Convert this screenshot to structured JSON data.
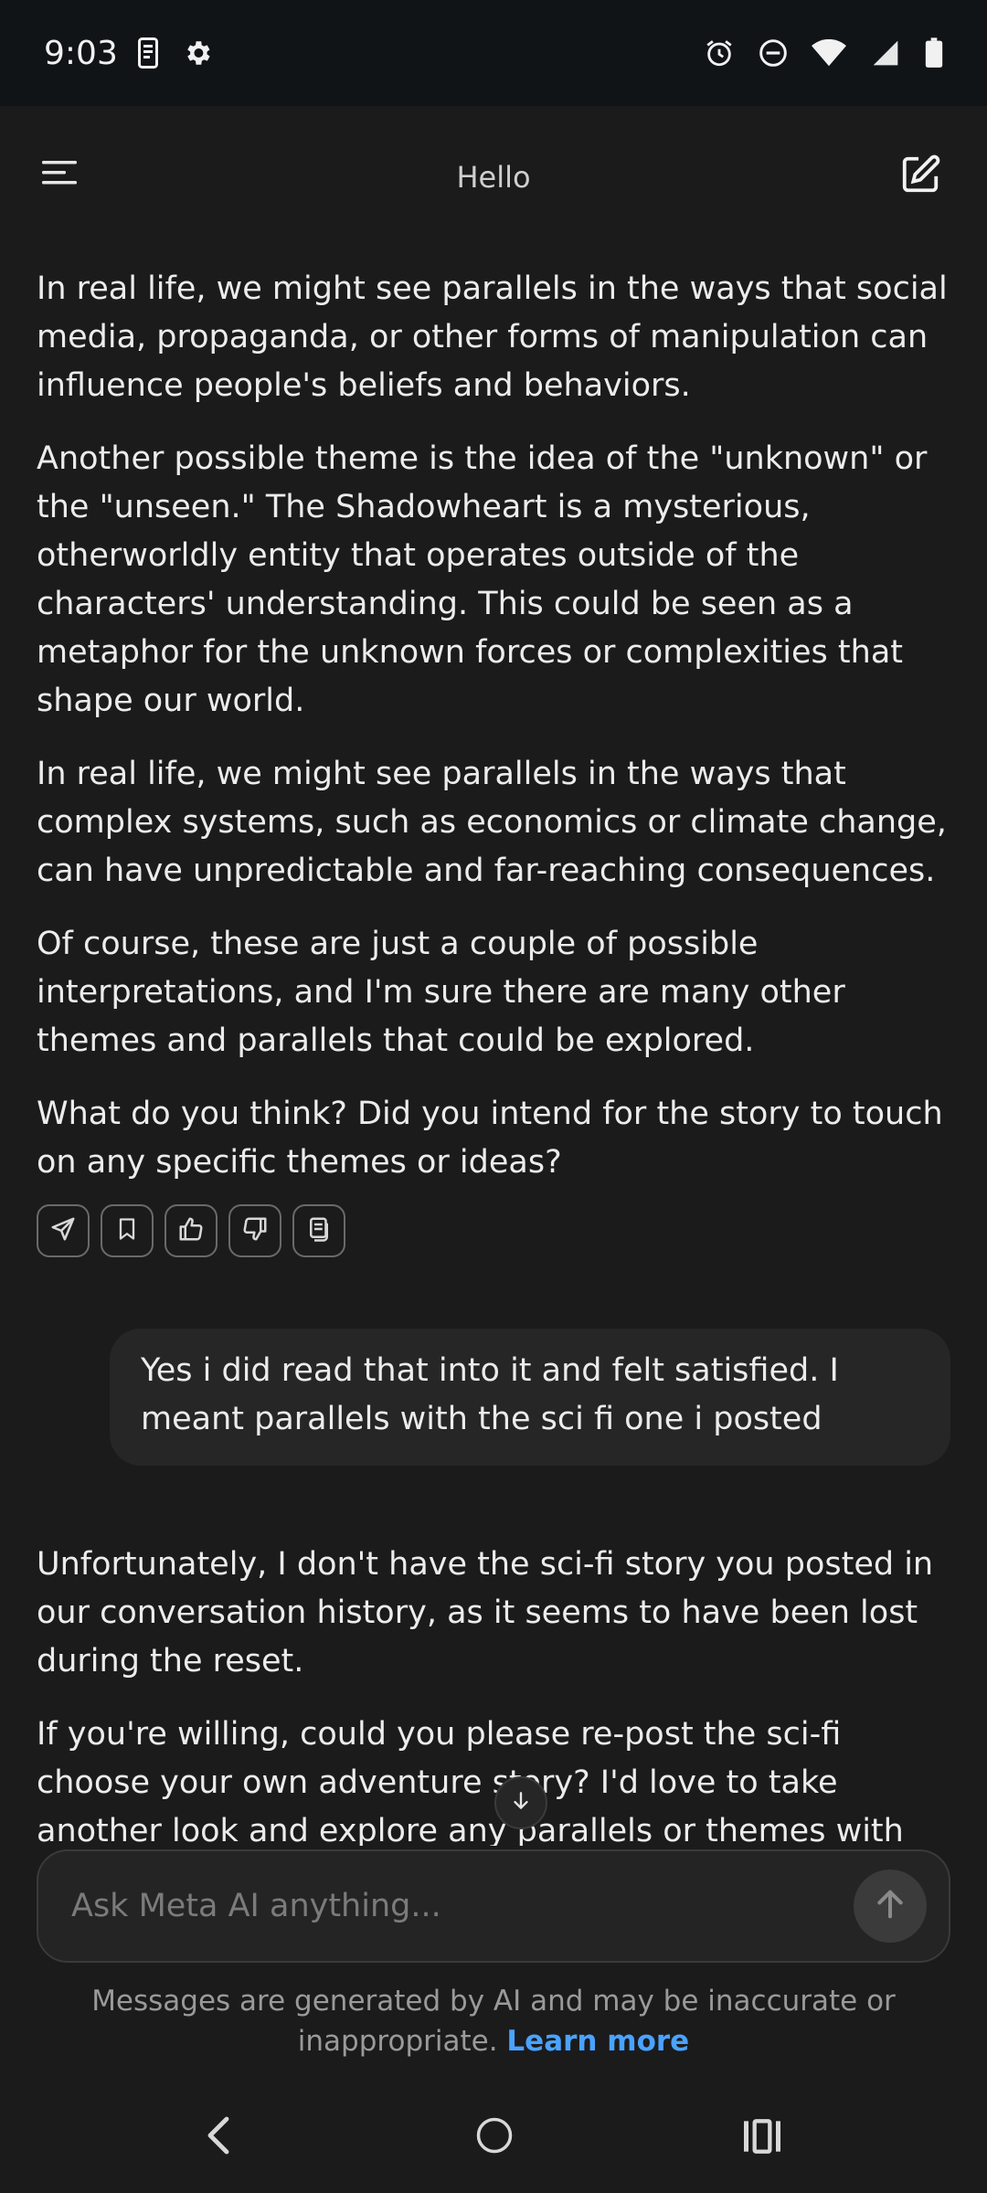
{
  "status_bar": {
    "time": "9:03",
    "icons": [
      "phone-screenshot-icon",
      "gear-icon",
      "alarm-icon",
      "do-not-disturb-icon",
      "wifi-icon",
      "signal-icon",
      "battery-icon"
    ]
  },
  "header": {
    "title": "Hello",
    "menu_icon": "menu-icon",
    "compose_icon": "compose-icon"
  },
  "conversation": {
    "ai_message_1": [
      "In real life, we might see parallels in the ways that social media, propaganda, or other forms of manipulation can influence people's beliefs and behaviors.",
      "Another possible theme is the idea of the \"unknown\" or the \"unseen.\" The Shadowheart is a mysterious, otherworldly entity that operates outside of the characters' understanding. This could be seen as a metaphor for the unknown forces or complexities that shape our world.",
      "In real life, we might see parallels in the ways that complex systems, such as economics or climate change, can have unpredictable and far-reaching consequences.",
      "Of course, these are just a couple of possible interpretations, and I'm sure there are many other themes and parallels that could be explored.",
      "What do you think? Did you intend for the story to touch on any specific themes or ideas?"
    ],
    "message_actions": [
      "share-icon",
      "bookmark-icon",
      "thumbs-up-icon",
      "thumbs-down-icon",
      "copy-icon"
    ],
    "user_message": "Yes i did read that into it and felt satisfied. I meant parallels with the sci fi one i posted",
    "ai_message_2": [
      "Unfortunately, I don't have the sci-fi story you posted in our conversation history, as it seems to have been lost during the reset.",
      "If you're willing, could you please re-post the sci-fi choose your own adventure story? I'd love to take another look and explore any parallels or themes with you!"
    ]
  },
  "composer": {
    "placeholder": "Ask Meta AI anything..."
  },
  "disclaimer": {
    "text": "Messages are generated by AI and may be inaccurate or inappropriate.",
    "link": "Learn more"
  },
  "colors": {
    "background": "#1b1b1c",
    "status_bar": "#111417",
    "link": "#4aa3ff"
  }
}
